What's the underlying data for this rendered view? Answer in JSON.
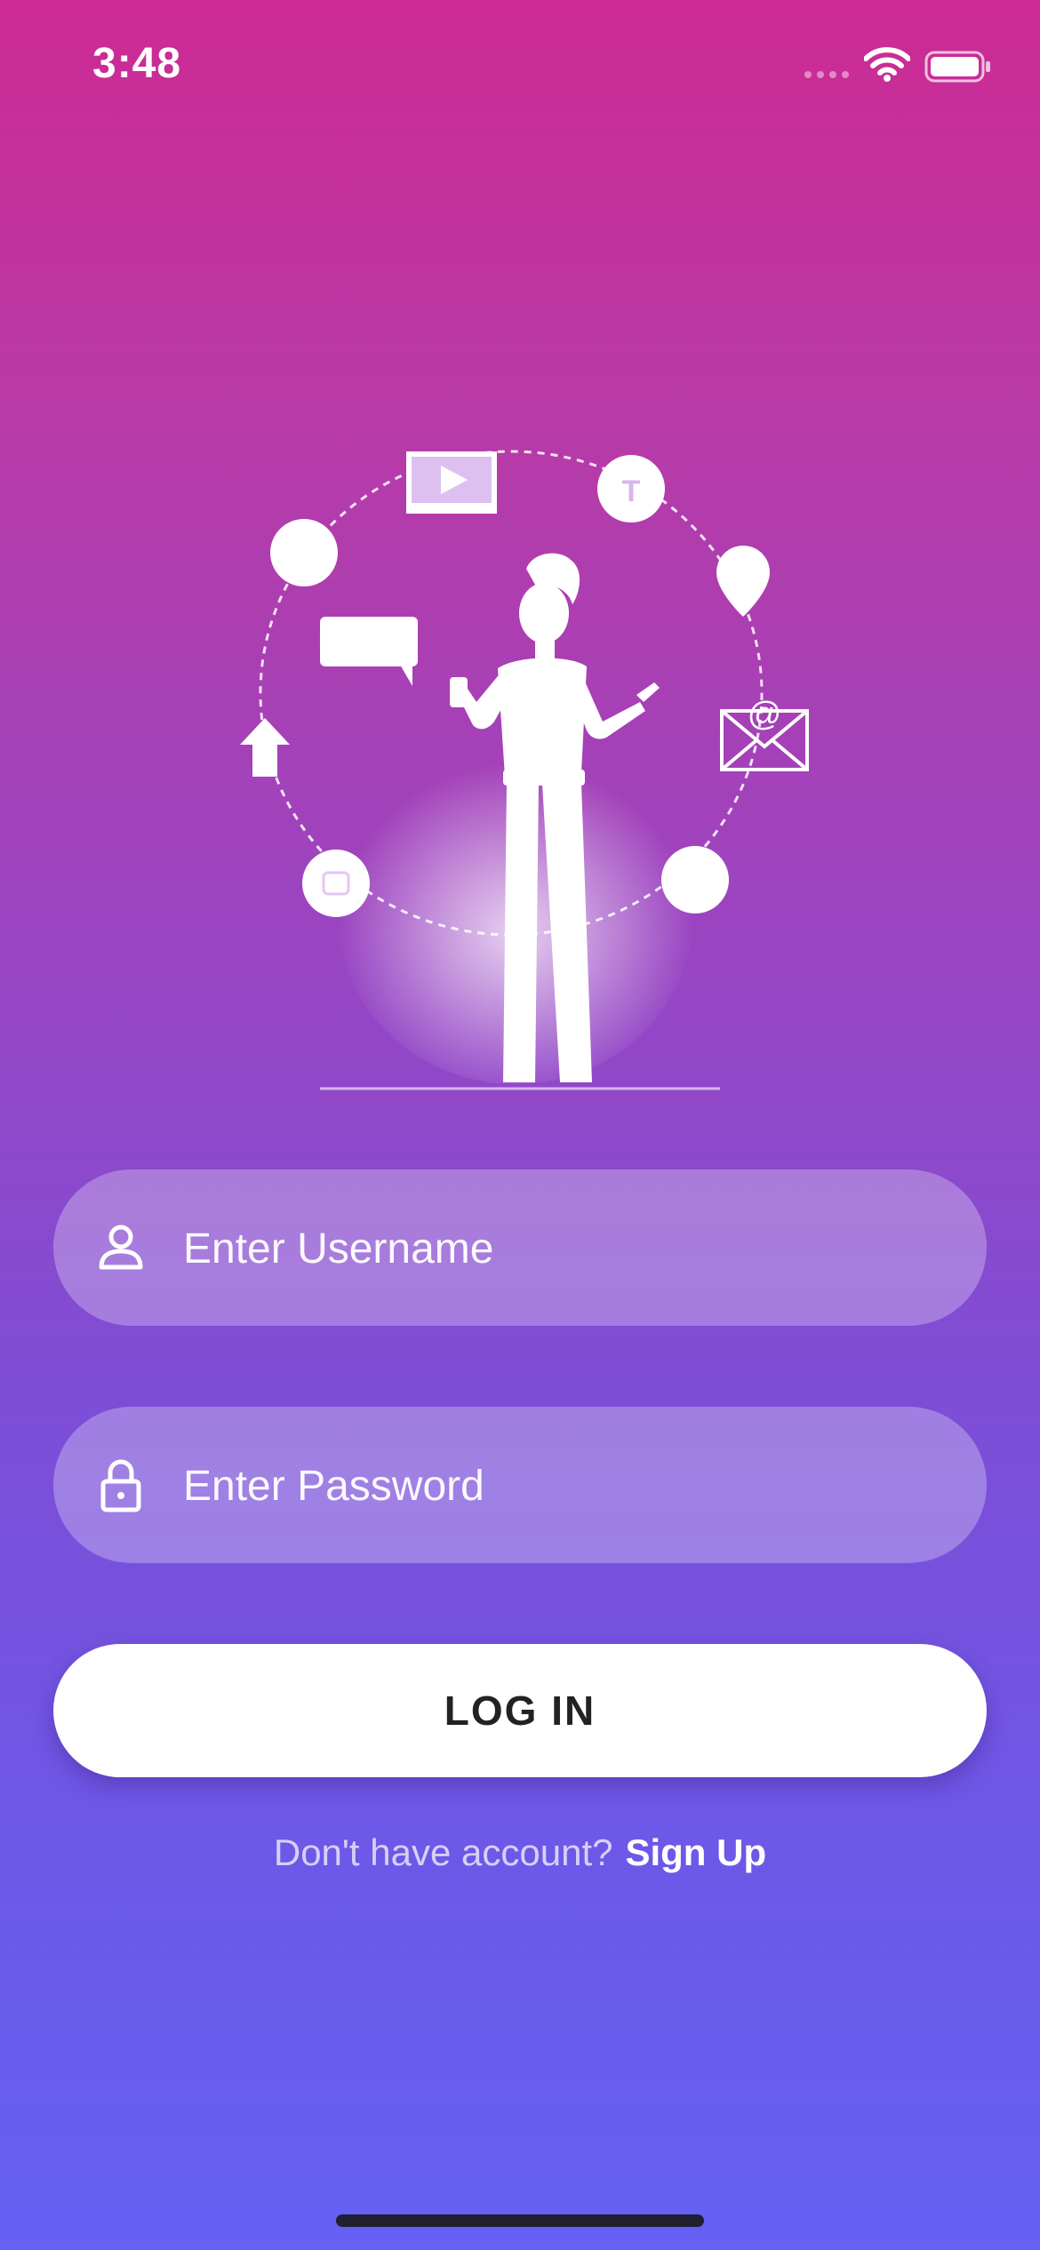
{
  "status_bar": {
    "time": "3:48",
    "icons": [
      "cellular-signal-icon",
      "wifi-icon",
      "battery-icon"
    ]
  },
  "illustration": {
    "description_icon": "person-with-social-icons-illustration",
    "icons": [
      "video-play-icon",
      "letter-t-circle-icon",
      "location-pin-icon",
      "envelope-at-icon",
      "chat-bubble-icon",
      "upload-arrow-icon",
      "camera-circle-icon",
      "leaf-circle-icon",
      "circle-icon"
    ]
  },
  "login_form": {
    "username": {
      "value": "",
      "placeholder": "Enter Username",
      "icon": "user-icon"
    },
    "password": {
      "value": "",
      "placeholder": "Enter Password",
      "icon": "lock-icon"
    },
    "login_label": "LOG IN"
  },
  "signup": {
    "prompt": "Don't have account?",
    "link_label": "Sign Up"
  },
  "colors": {
    "gradient_top": "#CD2A94",
    "gradient_bottom": "#6461F4",
    "button_bg": "#FFFFFF",
    "button_text": "#222222"
  }
}
